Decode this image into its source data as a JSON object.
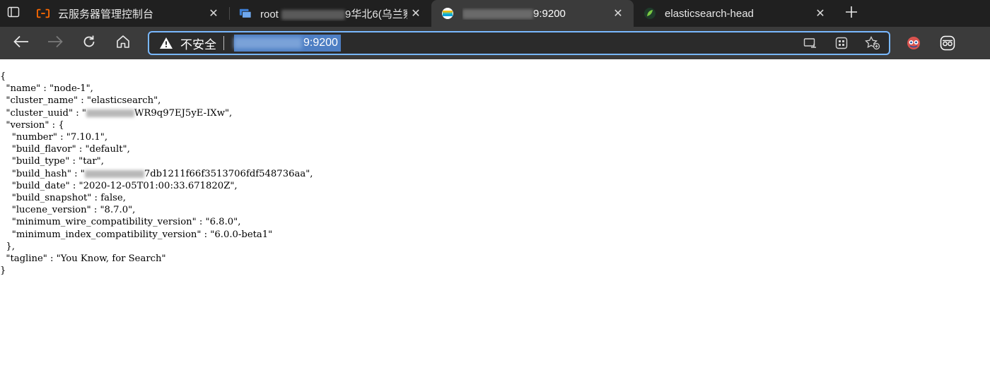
{
  "tabs": [
    {
      "title": "云服务器管理控制台",
      "icon": "aliyun-logo-icon",
      "active": false
    },
    {
      "title_prefix": "root",
      "title_suffix": "9华北6(乌兰察",
      "icon": "remote-desktop-icon",
      "active": false
    },
    {
      "title_suffix": "9:9200",
      "icon": "elasticsearch-icon",
      "active": true
    },
    {
      "title": "elasticsearch-head",
      "icon": "leaf-icon",
      "active": false
    }
  ],
  "address_bar": {
    "security_label": "不安全",
    "url_suffix": "9:9200"
  },
  "json": {
    "name_line": "  \"name\" : \"node-1\",",
    "cluster_name_line": "  \"cluster_name\" : \"elasticsearch\",",
    "cluster_uuid_prefix": "  \"cluster_uuid\" : \"",
    "cluster_uuid_suffix": "WR9q97EJ5yE-IXw\",",
    "version_open": "  \"version\" : {",
    "number_line": "    \"number\" : \"7.10.1\",",
    "build_flavor_line": "    \"build_flavor\" : \"default\",",
    "build_type_line": "    \"build_type\" : \"tar\",",
    "build_hash_prefix": "    \"build_hash\" : \"",
    "build_hash_suffix": "7db1211f66f3513706fdf548736aa\",",
    "build_date_line": "    \"build_date\" : \"2020-12-05T01:00:33.671820Z\",",
    "build_snapshot_line": "    \"build_snapshot\" : false,",
    "lucene_version_line": "    \"lucene_version\" : \"8.7.0\",",
    "min_wire_line": "    \"minimum_wire_compatibility_version\" : \"6.8.0\",",
    "min_index_line": "    \"minimum_index_compatibility_version\" : \"6.0.0-beta1\"",
    "version_close": "  },",
    "tagline_line": "  \"tagline\" : \"You Know, for Search\"",
    "open_brace": "{",
    "close_brace": "}"
  },
  "colors": {
    "tabbar_bg": "#202020",
    "toolbar_bg": "#3b3b3b",
    "address_border": "#79b8ff",
    "url_highlight": "#4e7fc4",
    "aliyun_orange": "#ff6a00"
  }
}
